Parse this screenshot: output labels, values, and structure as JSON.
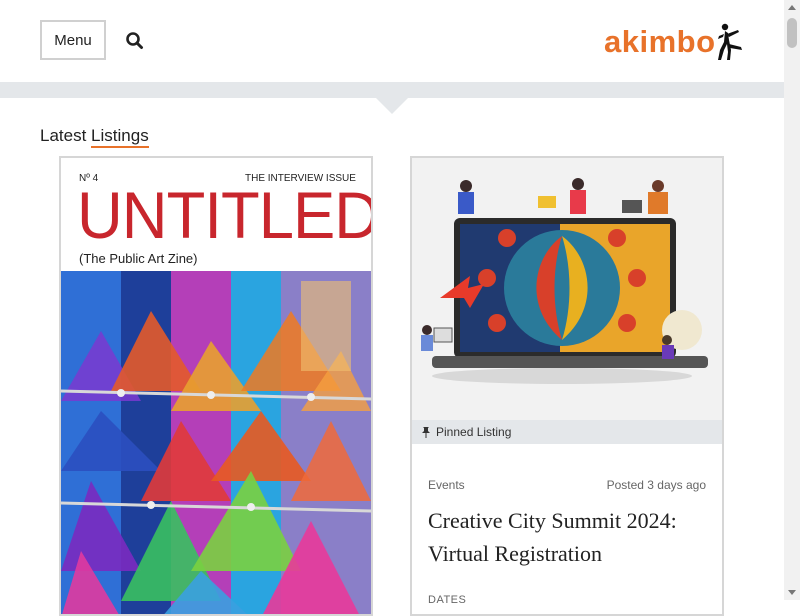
{
  "header": {
    "menu_label": "Menu",
    "search_icon": "search-icon",
    "logo_text": "akimbo",
    "logo_icon": "dancer-figure-icon"
  },
  "section": {
    "title_part1": "Latest ",
    "title_part2": "Listings"
  },
  "listings": [
    {
      "cover": {
        "number": "Nº 4",
        "issue": "THE INTERVIEW ISSUE",
        "title": "UNTITLED",
        "subtitle": "(The Public Art Zine)"
      }
    },
    {
      "pinned_label": "Pinned Listing",
      "category": "Events",
      "posted": "Posted 3 days ago",
      "title": "Creative City Summit 2024: Virtual Registration",
      "dates_label": "DATES"
    }
  ],
  "colors": {
    "accent": "#e8722a",
    "zine_red": "#c8262d",
    "band": "#e4e7ea"
  }
}
